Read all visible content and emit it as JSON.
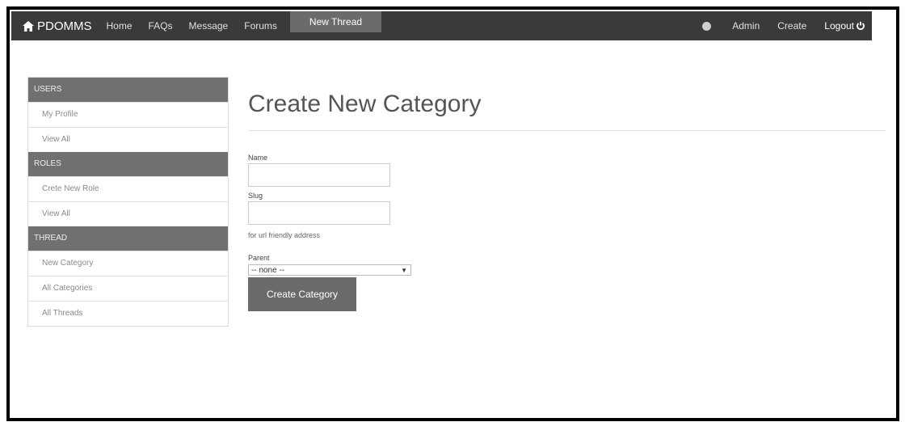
{
  "navbar": {
    "brand": "PDOMMS",
    "links": [
      "Home",
      "FAQs",
      "Message",
      "Forums"
    ],
    "active": "New Thread",
    "right": [
      "Admin",
      "Create"
    ],
    "logout": "Logout"
  },
  "sidebar": {
    "sections": [
      {
        "title": "USERS",
        "items": [
          "My Profile",
          "View All"
        ]
      },
      {
        "title": "ROLES",
        "items": [
          "Crete New Role",
          "View All"
        ]
      },
      {
        "title": "THREAD",
        "items": [
          "New Category",
          "All Categories",
          "All Threads"
        ]
      }
    ]
  },
  "main": {
    "title": "Create New Category",
    "name_label": "Name",
    "name_value": "",
    "slug_label": "Slug",
    "slug_value": "",
    "slug_help": "for url friendly address",
    "parent_label": "Parent",
    "parent_selected": "-- none --",
    "submit_label": "Create Category"
  }
}
